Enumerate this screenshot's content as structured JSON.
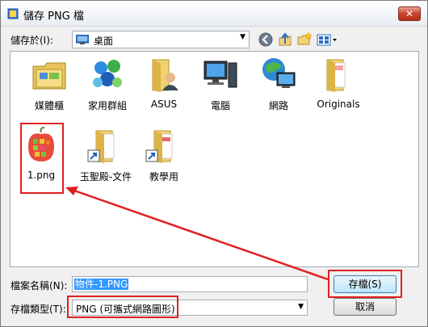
{
  "window": {
    "title": "儲存 PNG 檔"
  },
  "toolbar": {
    "savein_label": "儲存於(I):",
    "location": "桌面"
  },
  "items": [
    {
      "label": "媒體櫃",
      "icon": "library-folder-icon"
    },
    {
      "label": "家用群組",
      "icon": "homegroup-icon"
    },
    {
      "label": "ASUS",
      "icon": "user-folder-icon"
    },
    {
      "label": "電腦",
      "icon": "computer-icon"
    },
    {
      "label": "網路",
      "icon": "network-icon"
    },
    {
      "label": "Originals",
      "icon": "folder-icon"
    },
    {
      "label": "1.png",
      "icon": "png-image-icon"
    },
    {
      "label": "玉聖殿-文件",
      "icon": "folder-shortcut-icon"
    },
    {
      "label": "教學用",
      "icon": "folder-shortcut-icon"
    }
  ],
  "form": {
    "filename_label": "檔案名稱(N):",
    "filename_value": "物件-1.PNG",
    "filetype_label": "存檔類型(T):",
    "filetype_value": "PNG (可攜式網路圖形)"
  },
  "buttons": {
    "save": "存檔(S)",
    "cancel": "取消"
  },
  "colors": {
    "highlight": "#e02020",
    "selection": "#3399ff"
  }
}
